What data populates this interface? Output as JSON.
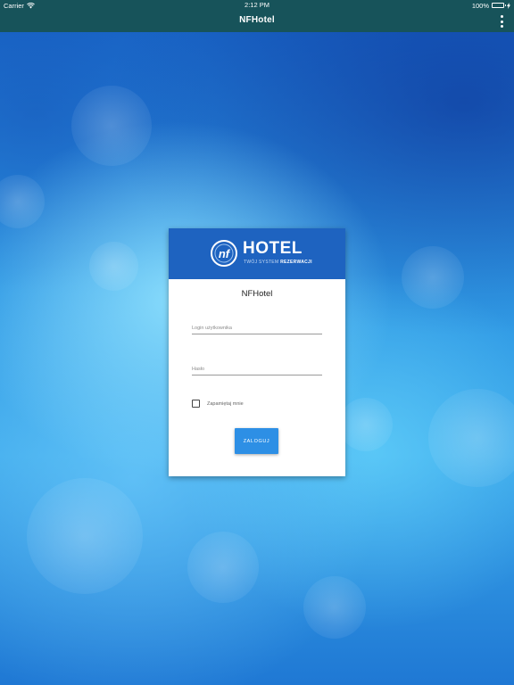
{
  "status_bar": {
    "carrier": "Carrier",
    "time": "2:12 PM",
    "battery": "100%",
    "battery_level": 1.0,
    "battery_color": "#7be07a"
  },
  "nav": {
    "title": "NFHotel",
    "menu_icon": "more-vertical-icon"
  },
  "colors": {
    "nav_bg": "#17535a",
    "card_header_bg": "#1e63c0",
    "button_bg": "#2d8fe5"
  },
  "logo": {
    "mark": "nf",
    "brand": "HOTEL",
    "tagline_prefix": "TWÓJ SYSTEM",
    "tagline_bold": "REZERWACJI"
  },
  "login": {
    "title": "NFHotel",
    "username_placeholder": "Login użytkownika",
    "username_value": "",
    "password_placeholder": "Hasło",
    "password_value": "",
    "remember_label": "Zapamiętaj mnie",
    "remember_checked": false,
    "submit_label": "ZALOGUJ"
  }
}
